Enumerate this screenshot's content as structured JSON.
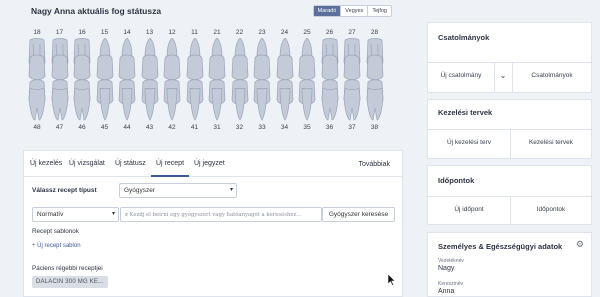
{
  "chart": {
    "title": "Nagy Anna aktuális fog státusza",
    "view_options": [
      "Maradó",
      "Vegyes",
      "Tejfog"
    ],
    "active_view": "Maradó",
    "upper_teeth": [
      "18",
      "17",
      "16",
      "15",
      "14",
      "13",
      "12",
      "11",
      "21",
      "22",
      "23",
      "24",
      "25",
      "26",
      "27",
      "28"
    ],
    "lower_teeth": [
      "48",
      "47",
      "46",
      "45",
      "44",
      "43",
      "42",
      "41",
      "31",
      "32",
      "33",
      "34",
      "35",
      "36",
      "37",
      "38"
    ]
  },
  "tabs": {
    "items": [
      "Új kezelés",
      "Új vizsgálat",
      "Új státusz",
      "Új recept",
      "Új jegyzet"
    ],
    "active": "Új recept",
    "more": "Továbbiak"
  },
  "recipe": {
    "type_label": "Válassz recept típust",
    "type_value": "Gyógyszer",
    "mode_value": "Normatív",
    "search_placeholder": "Kezdj el beírni egy gyógyszert vagy hatóanyagot a kereséshez...",
    "search_button": "Gyógyszer keresése",
    "templates_label": "Recept sablonok",
    "new_template_link": "+ Új recept sablon",
    "previous_label": "Páciens régebbi receptjei",
    "previous_item": "DALACIN 300 MG KE..."
  },
  "attachments": {
    "title": "Csatolmányok",
    "new_label": "Új csatolmány",
    "list_label": "Csatolmányok"
  },
  "treatment_plans": {
    "title": "Kezelési tervek",
    "new_label": "Új kezelési terv",
    "list_label": "Kezelési tervek"
  },
  "appointments": {
    "title": "Időpontok",
    "new_label": "Új időpont",
    "list_label": "Időpontok"
  },
  "personal": {
    "title": "Személyes & Egészségügyi adatok",
    "last_name_label": "Vezetéknév",
    "last_name": "Nagy",
    "first_name_label": "Keresztnév",
    "first_name": "Anna"
  }
}
